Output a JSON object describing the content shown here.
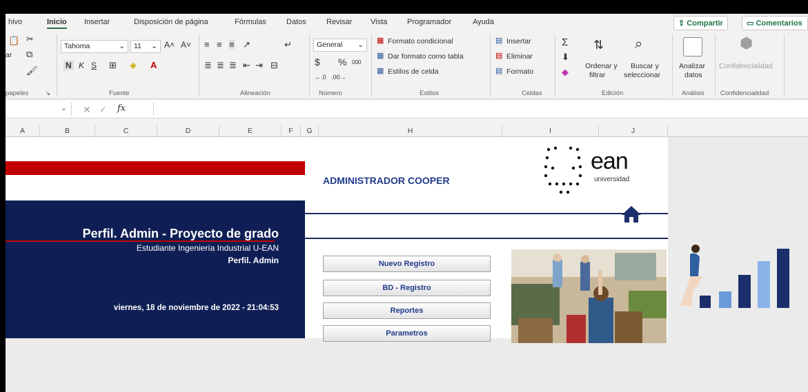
{
  "tabs": [
    "hivo",
    "Inicio",
    "Insertar",
    "Disposición de página",
    "Fórmulas",
    "Datos",
    "Revisar",
    "Vista",
    "Programador",
    "Ayuda"
  ],
  "active_tab": "Inicio",
  "share": {
    "share_label": "Compartir",
    "comments_label": "Comentarios"
  },
  "ribbon": {
    "clipboard": {
      "paste_label": "ar",
      "group_label": "papeles"
    },
    "font": {
      "font_name": "Tahoma",
      "font_size": "11",
      "bold": "N",
      "italic": "K",
      "underline": "S",
      "group_label": "Fuente"
    },
    "alignment": {
      "group_label": "Alineación"
    },
    "number": {
      "format": "General",
      "currency": "$",
      "percent": "%",
      "thousands": "000",
      "group_label": "Número"
    },
    "styles": {
      "conditional": "Formato condicional",
      "as_table": "Dar formato como tabla",
      "cell_styles": "Estilos de celda",
      "group_label": "Estilos"
    },
    "cells": {
      "insert": "Insertar",
      "delete": "Eliminar",
      "format": "Formato",
      "group_label": "Celdas"
    },
    "editing": {
      "sort_line1": "Ordenar y",
      "sort_line2": "filtrar",
      "find_line1": "Buscar y",
      "find_line2": "seleccionar",
      "group_label": "Edición"
    },
    "analysis": {
      "label_line1": "Analizar",
      "label_line2": "datos",
      "group_label": "Análisis"
    },
    "confidentiality": {
      "label": "Confidencialidad",
      "group_label": "Confidencialidad"
    }
  },
  "formula_bar": {
    "fx": "fx",
    "value": ""
  },
  "columns": [
    "A",
    "B",
    "C",
    "D",
    "E",
    "F",
    "G",
    "H",
    "I",
    "J"
  ],
  "sheet": {
    "header_title": "ADMINISTRADOR COOPER",
    "logo_text": "ean",
    "logo_sub": "universidad",
    "profile_title": "Perfil. Admin - Proyecto de grado",
    "profile_subtitle": "Estudiante Ingeniería Industrial  U-EAN",
    "profile_role": "Perfil. Admin",
    "datetime": "viernes, 18 de noviembre de 2022 - 21:04:53",
    "buttons": [
      "Nuevo Registro",
      "BD - Registro",
      "Reportes",
      "Parametros"
    ]
  },
  "colors": {
    "navy": "#0f1f55",
    "red": "#c00000",
    "excel_green": "#217346",
    "link_blue": "#1f3a8a"
  }
}
